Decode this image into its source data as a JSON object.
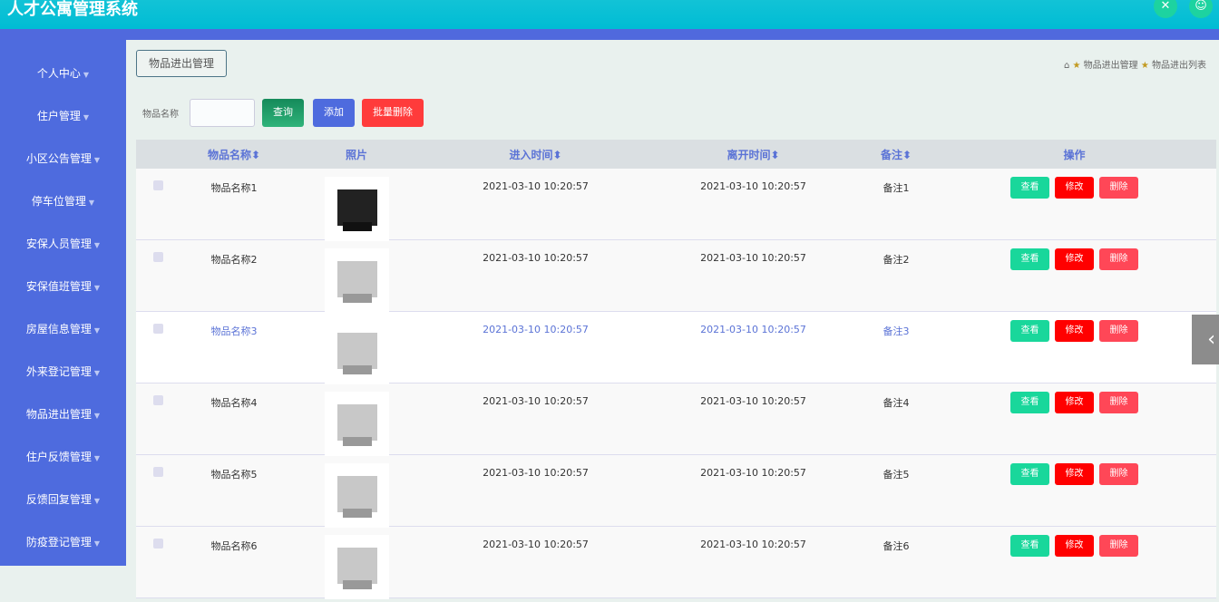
{
  "header": {
    "title": "人才公寓管理系统"
  },
  "sidebar": {
    "items": [
      "个人中心",
      "住户管理",
      "小区公告管理",
      "停车位管理",
      "安保人员管理",
      "安保值班管理",
      "房屋信息管理",
      "外来登记管理",
      "物品进出管理",
      "住户反馈管理",
      "反馈回复管理",
      "防疫登记管理"
    ]
  },
  "tab": "物品进出管理",
  "breadcrumb": [
    "物品进出管理",
    "物品进出列表"
  ],
  "search": {
    "label": "物品名称",
    "value": "",
    "query": "查询",
    "add": "添加",
    "batch_delete": "批量删除"
  },
  "table": {
    "headers": [
      "物品名称",
      "照片",
      "进入时间",
      "离开时间",
      "备注",
      "操作"
    ],
    "rows": [
      {
        "name": "物品名称1",
        "in": "2021-03-10 10:20:57",
        "out": "2021-03-10 10:20:57",
        "note": "备注1"
      },
      {
        "name": "物品名称2",
        "in": "2021-03-10 10:20:57",
        "out": "2021-03-10 10:20:57",
        "note": "备注2"
      },
      {
        "name": "物品名称3",
        "in": "2021-03-10 10:20:57",
        "out": "2021-03-10 10:20:57",
        "note": "备注3"
      },
      {
        "name": "物品名称4",
        "in": "2021-03-10 10:20:57",
        "out": "2021-03-10 10:20:57",
        "note": "备注4"
      },
      {
        "name": "物品名称5",
        "in": "2021-03-10 10:20:57",
        "out": "2021-03-10 10:20:57",
        "note": "备注5"
      },
      {
        "name": "物品名称6",
        "in": "2021-03-10 10:20:57",
        "out": "2021-03-10 10:20:57",
        "note": "备注6"
      }
    ],
    "actions": {
      "view": "查看",
      "edit": "修改",
      "delete": "删除"
    }
  },
  "colors": {
    "topbar": "#00bcd4",
    "sidebar": "#4e6bde",
    "query": "#1e9e6a",
    "add": "#4e6bde",
    "batch": "#ff3b3b",
    "view": "#19d79b",
    "edit": "#ff0000",
    "delete": "#ff4757"
  }
}
